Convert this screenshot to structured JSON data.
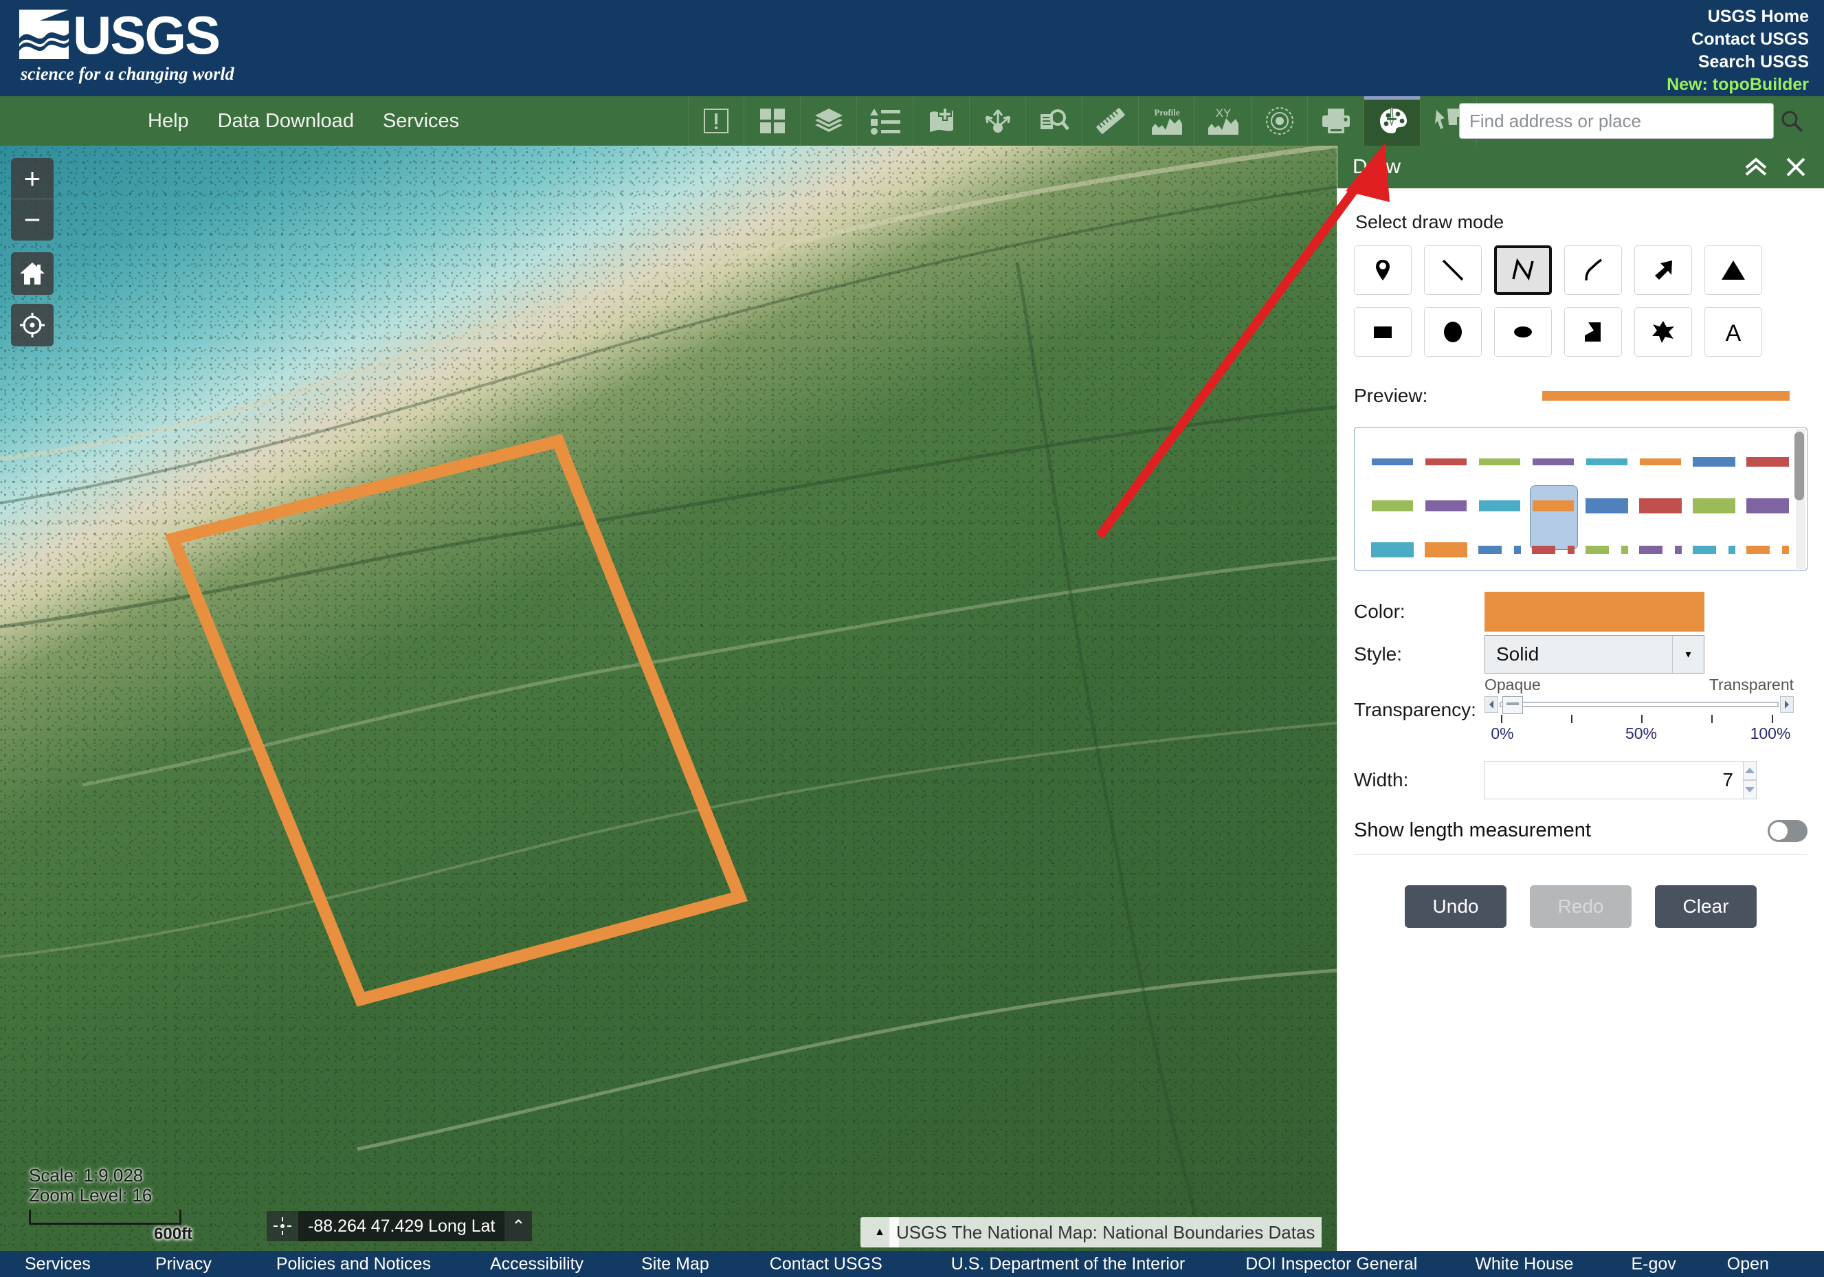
{
  "header": {
    "logo_text": "USGS",
    "logo_tagline": "science for a changing world",
    "links": [
      {
        "label": "USGS Home",
        "accent": false
      },
      {
        "label": "Contact USGS",
        "accent": false
      },
      {
        "label": "Search USGS",
        "accent": false
      },
      {
        "label": "New: topoBuilder",
        "accent": true
      }
    ]
  },
  "toolbar": {
    "menu": [
      "Help",
      "Data Download",
      "Services"
    ],
    "tools": [
      {
        "name": "alert-icon",
        "active": false
      },
      {
        "name": "basemap-grid-icon",
        "active": false
      },
      {
        "name": "layers-icon",
        "active": false
      },
      {
        "name": "legend-icon",
        "active": false
      },
      {
        "name": "add-data-icon",
        "active": false
      },
      {
        "name": "share-icon",
        "active": false
      },
      {
        "name": "identify-search-icon",
        "active": false
      },
      {
        "name": "measure-ruler-icon",
        "active": false
      },
      {
        "name": "elevation-profile-icon",
        "active": false,
        "label": "Profile"
      },
      {
        "name": "xy-profile-icon",
        "active": false,
        "label": "XY"
      },
      {
        "name": "bookmark-target-icon",
        "active": false
      },
      {
        "name": "print-icon",
        "active": false
      },
      {
        "name": "draw-palette-icon",
        "active": true
      },
      {
        "name": "select-features-icon",
        "active": false
      }
    ]
  },
  "search": {
    "placeholder": "Find address or place",
    "value": "",
    "icon": "magnifier-icon"
  },
  "map": {
    "controls": {
      "zoom_in": "+",
      "zoom_out": "−",
      "home": "home-icon",
      "locate": "crosshair-icon"
    },
    "scale_text": "Scale: 1:9,028",
    "zoom_level_text": "Zoom Level: 16",
    "scale_bar_label": "600ft",
    "coordinates": "-88.264 47.429 Long Lat",
    "coord_icon": "crosshair-small-icon",
    "coord_caret": "⌃",
    "attribution": "USGS The National Map: National Boundaries Datas",
    "attribution_toggle": "▲",
    "drawn_shape_color": "#E8903F",
    "annotation_arrow_color": "#E02020"
  },
  "draw_panel": {
    "title": "Draw",
    "collapse_icon": "chevron-double-up-icon",
    "close_icon": "close-x-icon",
    "select_mode_label": "Select draw mode",
    "modes": [
      {
        "name": "point-icon",
        "selected": false
      },
      {
        "name": "line-icon",
        "selected": false
      },
      {
        "name": "polyline-icon",
        "selected": true
      },
      {
        "name": "freehand-line-icon",
        "selected": false
      },
      {
        "name": "arrow-icon",
        "selected": false
      },
      {
        "name": "triangle-icon",
        "selected": false
      },
      {
        "name": "rectangle-icon",
        "selected": false
      },
      {
        "name": "circle-icon",
        "selected": false
      },
      {
        "name": "ellipse-icon",
        "selected": false
      },
      {
        "name": "polygon-icon",
        "selected": false
      },
      {
        "name": "freehand-polygon-icon",
        "selected": false
      },
      {
        "name": "text-icon",
        "selected": false
      }
    ],
    "preview_label": "Preview:",
    "preview_color": "#E8903F",
    "symbols": {
      "selected_index": 11,
      "rows": [
        {
          "height": 10,
          "cells": [
            {
              "color": "#4F81BD",
              "width": 60
            },
            {
              "color": "#C0504D",
              "width": 60
            },
            {
              "color": "#9BBB59",
              "width": 60
            },
            {
              "color": "#8064A2",
              "width": 60
            },
            {
              "color": "#4BACC6",
              "width": 60
            },
            {
              "color": "#E8903F",
              "width": 60
            },
            {
              "color": "#4F81BD",
              "width": 62
            },
            {
              "color": "#C0504D",
              "width": 62
            }
          ]
        },
        {
          "height": 20,
          "cells": [
            {
              "color": "#9BBB59",
              "width": 60
            },
            {
              "color": "#8064A2",
              "width": 60
            },
            {
              "color": "#4BACC6",
              "width": 60
            },
            {
              "color": "#E8903F",
              "width": 60
            },
            {
              "color": "#4F81BD",
              "width": 62
            },
            {
              "color": "#C0504D",
              "width": 62
            },
            {
              "color": "#9BBB59",
              "width": 62
            },
            {
              "color": "#8064A2",
              "width": 62
            }
          ]
        },
        {
          "height": 22,
          "cells": [
            {
              "color": "#4BACC6",
              "width": 62
            },
            {
              "color": "#E8903F",
              "width": 62
            },
            {
              "color": "#4F81BD",
              "width": 34,
              "dashed": true
            },
            {
              "color": "#C0504D",
              "width": 34,
              "dashed": true
            },
            {
              "color": "#9BBB59",
              "width": 34,
              "dashed": true
            },
            {
              "color": "#8064A2",
              "width": 34,
              "dashed": true
            },
            {
              "color": "#4BACC6",
              "width": 34,
              "dashed": true
            },
            {
              "color": "#E8903F",
              "width": 34,
              "dashed": true
            }
          ]
        }
      ]
    },
    "color_label": "Color:",
    "color_value": "#E8903F",
    "style_label": "Style:",
    "style_value": "Solid",
    "style_arrow": "▾",
    "transparency_label": "Transparency:",
    "transparency_min_label": "Opaque",
    "transparency_max_label": "Transparent",
    "transparency_value": 0,
    "transparency_ticks": [
      "0%",
      "50%",
      "100%"
    ],
    "width_label": "Width:",
    "width_value": "7",
    "measurement_label": "Show length measurement",
    "measurement_on": false,
    "actions": [
      {
        "label": "Undo",
        "disabled": false
      },
      {
        "label": "Redo",
        "disabled": true
      },
      {
        "label": "Clear",
        "disabled": false
      }
    ]
  },
  "footer": {
    "links": [
      "Services",
      "Privacy",
      "Policies and Notices",
      "Accessibility",
      "Site Map",
      "Contact USGS",
      "U.S. Department of the Interior",
      "DOI Inspector General",
      "White House",
      "E-gov",
      "Open"
    ]
  }
}
